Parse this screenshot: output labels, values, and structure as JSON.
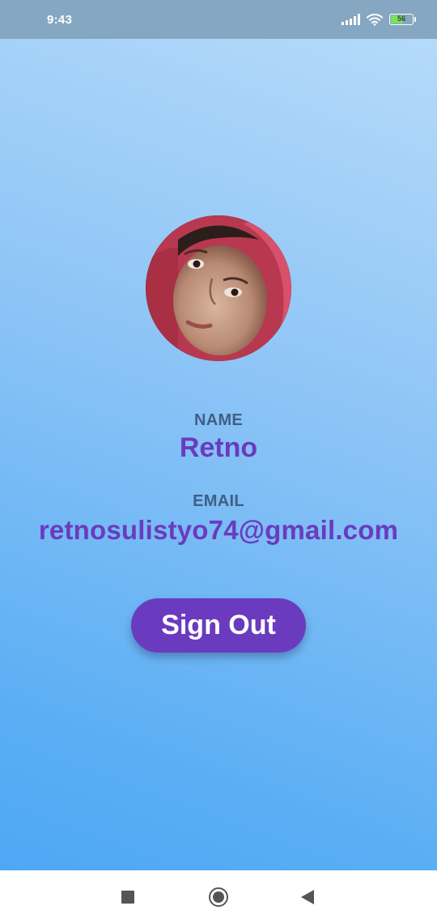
{
  "status_bar": {
    "time": "9:43",
    "battery_level": "56",
    "icons": [
      "signal-icon",
      "wifi-icon",
      "battery-icon"
    ]
  },
  "profile": {
    "name_label": "NAME",
    "name": "Retno",
    "email_label": "EMAIL",
    "email": "retnosulistyo74@gmail.com"
  },
  "actions": {
    "sign_out_label": "Sign Out"
  },
  "nav_bar": {
    "icons": [
      "recents-icon",
      "home-icon",
      "back-icon"
    ]
  },
  "colors": {
    "accent": "#6a3bbf",
    "label": "#3f5f86",
    "background_top": "#b9dcfa",
    "background_bottom": "#4aa5f4",
    "status_bar": "#86a7c1"
  }
}
